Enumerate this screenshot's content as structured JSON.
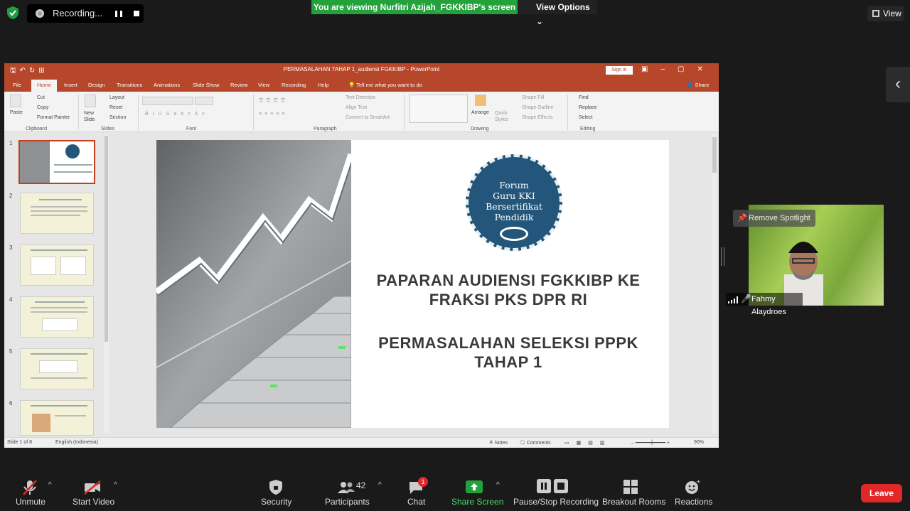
{
  "recording": {
    "label": "Recording..."
  },
  "share_banner": {
    "text": "You are viewing Nurfitri Azijah_FGKKIBP's screen",
    "options": "View Options ⌄"
  },
  "view_button": {
    "label": "View"
  },
  "powerpoint": {
    "title": "PERMASALAHAN TAHAP 1_audiensi FGKKIBP  -  PowerPoint",
    "sign_in": "Sign in",
    "tabs": [
      "File",
      "Home",
      "Insert",
      "Design",
      "Transitions",
      "Animations",
      "Slide Show",
      "Review",
      "View",
      "Recording",
      "Help"
    ],
    "tell_me": "Tell me what you want to do",
    "share": "Share",
    "ribbon": {
      "paste": "Paste",
      "cut": "Cut",
      "copy": "Copy",
      "format_painter": "Format Painter",
      "clipboard": "Clipboard",
      "new_slide": "New Slide",
      "layout": "Layout",
      "reset": "Reset",
      "section": "Section",
      "slides": "Slides",
      "font": "Font",
      "text_direction": "Text Direction",
      "align_text": "Align Text",
      "convert_smartart": "Convert to SmartArt",
      "paragraph": "Paragraph",
      "arrange": "Arrange",
      "quick_styles": "Quick Styles",
      "shape_fill": "Shape Fill",
      "shape_outline": "Shape Outline",
      "shape_effects": "Shape Effects",
      "drawing": "Drawing",
      "find": "Find",
      "replace": "Replace",
      "select": "Select",
      "editing": "Editing"
    },
    "thumbnails": [
      "1",
      "2",
      "3",
      "4",
      "5",
      "6"
    ],
    "slide": {
      "logo_lines": [
        "Forum",
        "Guru KKI",
        "Bersertifikat",
        "Pendidik"
      ],
      "title1_line1": "PAPARAN AUDIENSI FGKKIBP KE",
      "title1_line2": "FRAKSI PKS DPR RI",
      "title2_line1": "PERMASALAHAN SELEKSI PPPK",
      "title2_line2": "TAHAP 1"
    },
    "status": {
      "slide_count": "Slide 1 of 8",
      "language": "English (Indonesia)",
      "notes": "Notes",
      "comments": "Comments",
      "zoom": "90%"
    }
  },
  "video": {
    "name": "Fahmy Alaydroes",
    "spotlight": "Remove Spotlight"
  },
  "toolbar": {
    "unmute": "Unmute",
    "start_video": "Start Video",
    "security": "Security",
    "participants": "Participants",
    "participant_count": "42",
    "chat": "Chat",
    "chat_badge": "1",
    "share_screen": "Share Screen",
    "pause_stop": "Pause/Stop Recording",
    "breakout": "Breakout Rooms",
    "reactions": "Reactions",
    "leave": "Leave"
  }
}
